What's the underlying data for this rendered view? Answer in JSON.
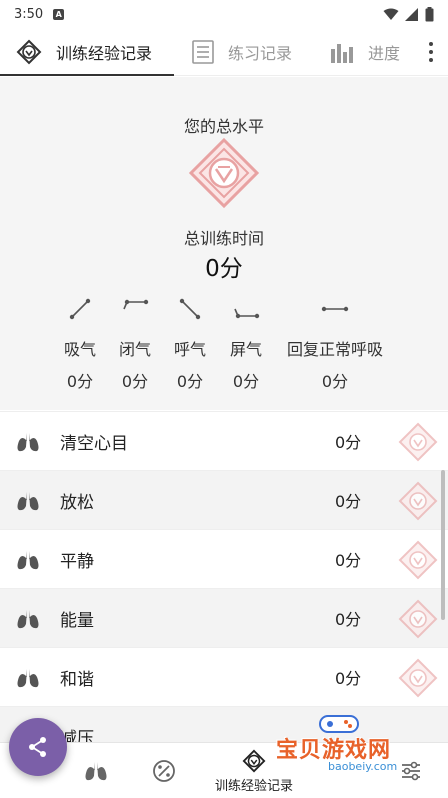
{
  "status_bar": {
    "time": "3:50",
    "notification_badge": "A"
  },
  "tabs": [
    {
      "label": "训练经验记录",
      "icon": "medal-icon",
      "active": true
    },
    {
      "label": "练习记录",
      "icon": "list-icon",
      "active": false
    },
    {
      "label": "进度",
      "icon": "bar-chart-icon",
      "active": false
    }
  ],
  "summary": {
    "level_label": "您的总水平",
    "total_time_label": "总训练时间",
    "total_time_value": "0分",
    "phases": [
      {
        "label": "吸气",
        "value": "0分",
        "icon": "inhale-icon"
      },
      {
        "label": "闭气",
        "value": "0分",
        "icon": "hold-icon"
      },
      {
        "label": "呼气",
        "value": "0分",
        "icon": "exhale-icon"
      },
      {
        "label": "屏气",
        "value": "0分",
        "icon": "hold-after-icon"
      },
      {
        "label": "回复正常呼吸",
        "value": "0分",
        "icon": "recover-icon"
      }
    ]
  },
  "exercises": [
    {
      "name": "清空心目",
      "minutes": "0分"
    },
    {
      "name": "放松",
      "minutes": "0分"
    },
    {
      "name": "平静",
      "minutes": "0分"
    },
    {
      "name": "能量",
      "minutes": "0分"
    },
    {
      "name": "和谐",
      "minutes": "0分"
    },
    {
      "name": "减压",
      "minutes": ""
    }
  ],
  "bottom_nav": {
    "items": [
      {
        "icon": "lungs-icon",
        "label": ""
      },
      {
        "icon": "percent-icon",
        "label": ""
      },
      {
        "icon": "medal-icon",
        "label": "训练经验记录",
        "active": true
      },
      {
        "icon": "settings-sliders-icon",
        "label": ""
      }
    ]
  },
  "watermark": {
    "text": "宝贝游戏网",
    "url": "baobeiy.com"
  },
  "colors": {
    "accent_purple": "#7b5fa8",
    "medal_pink": "#e8a2a2",
    "summary_bg": "#f5f5f5",
    "watermark_orange": "#e8622a"
  }
}
